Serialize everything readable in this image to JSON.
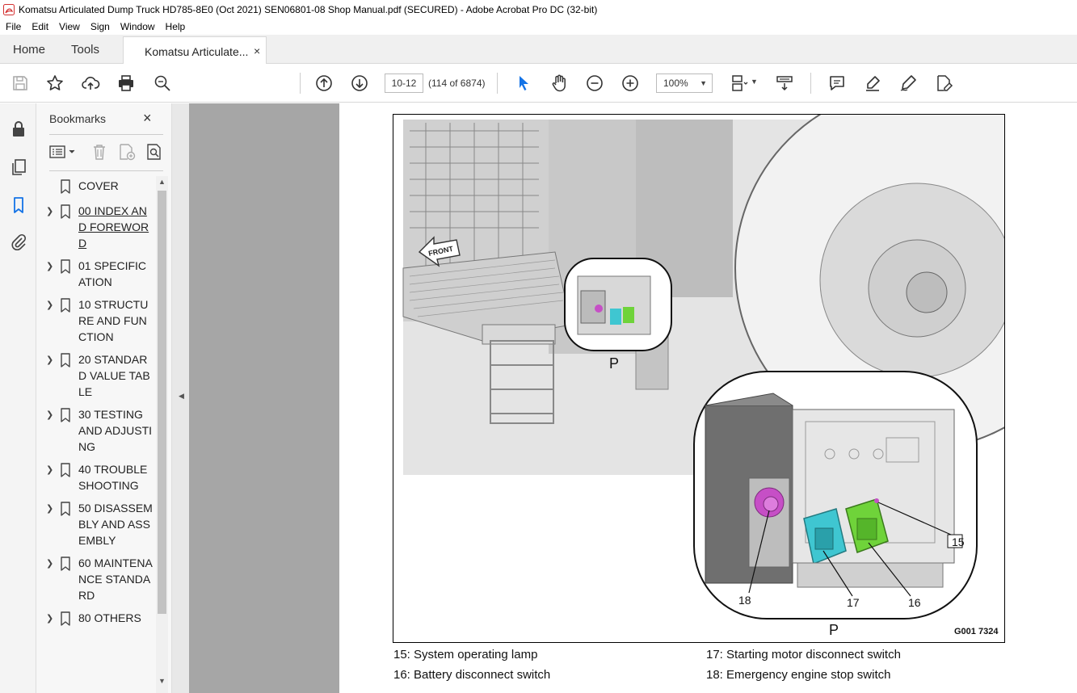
{
  "window": {
    "title": "Komatsu Articulated Dump Truck HD785-8E0 (Oct 2021) SEN06801-08 Shop Manual.pdf (SECURED) - Adobe Acrobat Pro DC (32-bit)"
  },
  "menu": {
    "items": [
      "File",
      "Edit",
      "View",
      "Sign",
      "Window",
      "Help"
    ]
  },
  "tabs": {
    "home": "Home",
    "tools": "Tools",
    "document": "Komatsu Articulate...",
    "close": "×"
  },
  "toolbar": {
    "page_field": "10-12",
    "page_count": "(114 of 6874)",
    "zoom": "100%"
  },
  "bookmarks": {
    "title": "Bookmarks",
    "close": "×",
    "items": [
      {
        "label": "COVER",
        "expandable": false,
        "underline": false
      },
      {
        "label": " 00 INDEX AND FOREWORD",
        "expandable": true,
        "underline": true
      },
      {
        "label": " 01 SPECIFICATION",
        "expandable": true,
        "underline": false
      },
      {
        "label": " 10 STRUCTURE AND FUNCTION",
        "expandable": true,
        "underline": false
      },
      {
        "label": " 20 STANDARD VALUE TABLE",
        "expandable": true,
        "underline": false
      },
      {
        "label": " 30 TESTING AND ADJUSTING",
        "expandable": true,
        "underline": false
      },
      {
        "label": " 40 TROUBLESHOOTING",
        "expandable": true,
        "underline": false
      },
      {
        "label": " 50 DISASSEMBLY AND ASSEMBLY",
        "expandable": true,
        "underline": false
      },
      {
        "label": " 60 MAINTENANCE STANDARD",
        "expandable": true,
        "underline": false
      },
      {
        "label": " 80 OTHERS",
        "expandable": true,
        "underline": false
      }
    ]
  },
  "figure": {
    "front_label": "FRONT",
    "detail_label_small": "P",
    "detail_label_large": "P",
    "code": "G001 7324",
    "callouts": [
      "15",
      "16",
      "17",
      "18"
    ]
  },
  "captions": {
    "c15": "15: System operating lamp",
    "c16": "16: Battery disconnect switch",
    "c17": "17: Starting motor disconnect switch",
    "c18": "18: Emergency engine stop switch"
  },
  "colors": {
    "pink": "#c64fc6",
    "cyan": "#3fc6d1",
    "green": "#6fd33a"
  }
}
